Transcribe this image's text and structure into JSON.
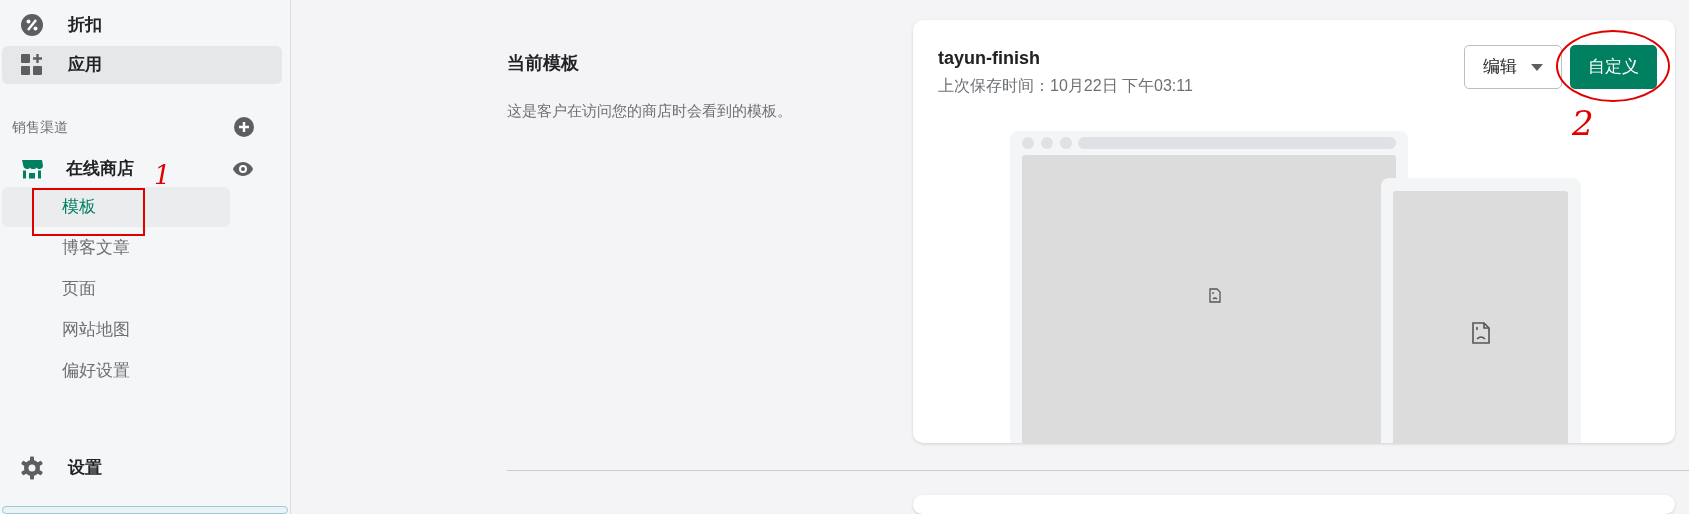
{
  "sidebar": {
    "items": [
      {
        "label": "折扣",
        "kind": "discount",
        "highlighted": false
      },
      {
        "label": "应用",
        "kind": "apps",
        "highlighted": true
      }
    ],
    "channels": {
      "heading": "销售渠道",
      "store": {
        "label": "在线商店",
        "children": [
          {
            "label": "模板",
            "selected": true
          },
          {
            "label": "博客文章",
            "selected": false
          },
          {
            "label": "页面",
            "selected": false
          },
          {
            "label": "网站地图",
            "selected": false
          },
          {
            "label": "偏好设置",
            "selected": false
          }
        ]
      }
    },
    "settings": {
      "label": "设置"
    }
  },
  "section": {
    "title": "当前模板",
    "description": "这是客户在访问您的商店时会看到的模板。"
  },
  "theme_card": {
    "name": "tayun-finish",
    "saved": "上次保存时间：10月22日 下午03:11",
    "edit_button": "编辑",
    "customize_button": "自定义"
  },
  "annotations": {
    "labels": [
      "1",
      "2"
    ]
  }
}
